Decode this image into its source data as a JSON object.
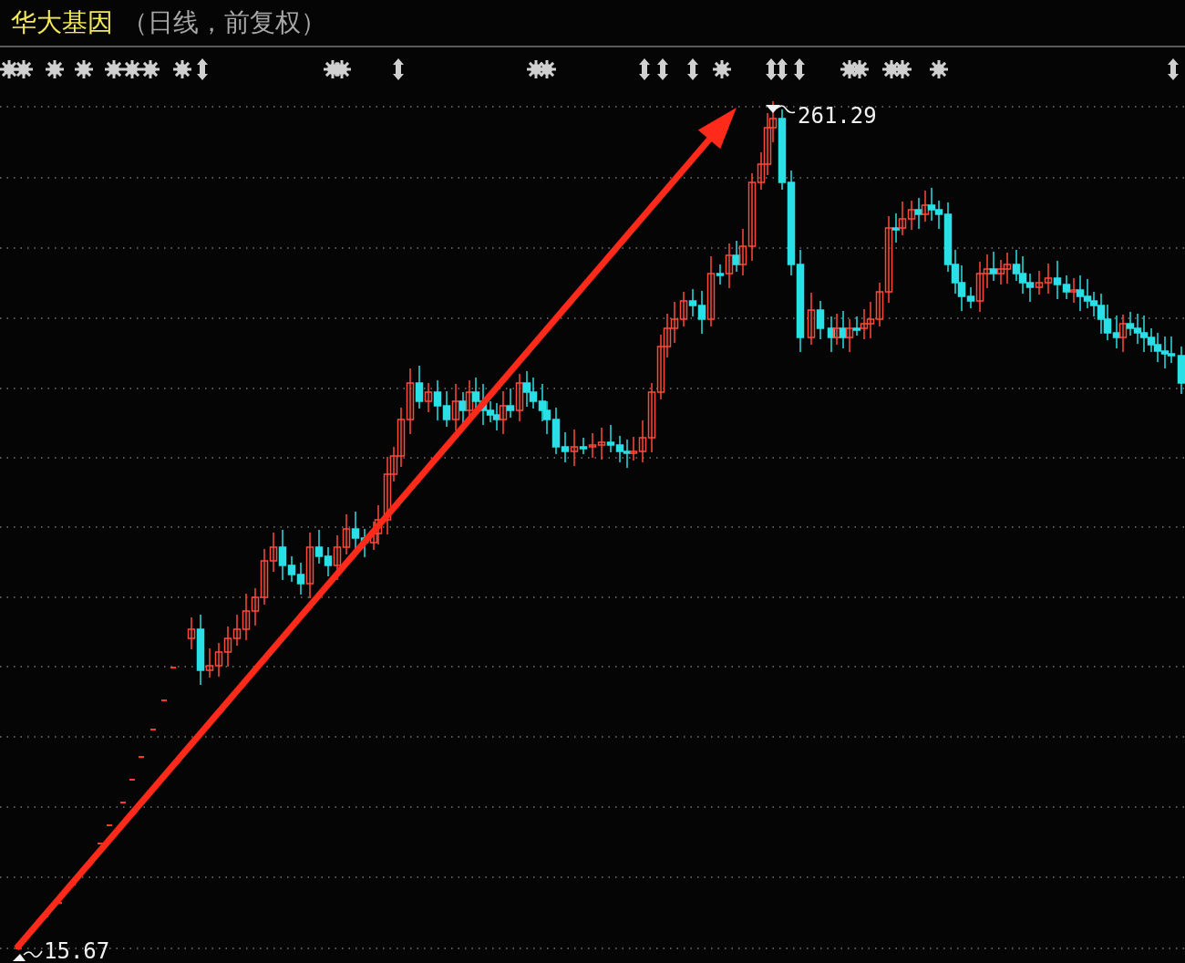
{
  "header": {
    "title": "华大基因",
    "subtitle": "（日线，前复权）"
  },
  "chart": {
    "high_label": "261.29",
    "low_label": "15.67"
  }
}
